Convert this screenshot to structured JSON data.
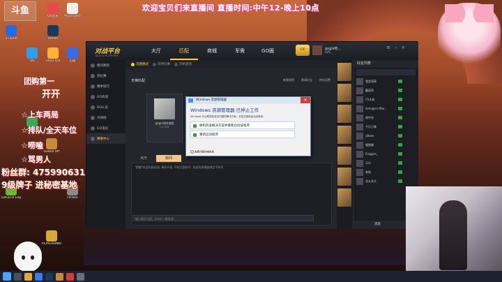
{
  "banner": {
    "text": "欢迎宝贝们来直播间   直播时间:中午12-晚上10点"
  },
  "logo_text": "斗鱼",
  "overlay": {
    "line1": "团购第一",
    "line2": "开开",
    "line3": "☆上车两局",
    "line4": "☆排队/全天车位",
    "line5": "☆唠嗑",
    "line6": "☆骂男人",
    "line7": "粉丝群: 475990631",
    "line8": "9级牌子 进秘密基地"
  },
  "desktop_icons": [
    {
      "label": "373200"
    },
    {
      "label": "QQ音乐"
    },
    {
      "label": "My project"
    },
    {
      "label": "Steam"
    },
    {
      "label": "QQ"
    },
    {
      "label": "2022 QQ"
    },
    {
      "label": "迅雷"
    },
    {
      "label": "360安全"
    },
    {
      "label": "Global Off"
    },
    {
      "label": "GeForce Experience"
    },
    {
      "label": "PLAYERUNKNOWN BATTLEGROUNDS"
    },
    {
      "label": "FitTake"
    }
  ],
  "app": {
    "logo": "对战平台",
    "logo_sub": "BATTLE PLATFORM",
    "nav": [
      "大厅",
      "匹配",
      "商城",
      "军需",
      "GO圈"
    ],
    "nav_active": 1,
    "vip_label": "VIP",
    "user_name": "gogis吧...",
    "level": "LV5",
    "sidebar": [
      "模块教程",
      "排位赛",
      "赛季排行",
      "GO商城",
      "ROLL房",
      "天梯榜",
      "GO电竞",
      "赛事中心"
    ],
    "sidebar_active": 7,
    "subnav": [
      "选图模式",
      "等待比赛",
      "开始游戏"
    ],
    "match_title": "天梯匹配",
    "match_tools": [
      "查看规则",
      "邀请好友",
      "房间设置"
    ],
    "room_name": "gogis吧的地图",
    "room_ip": "ELO988",
    "chat_tabs": [
      "大厅",
      "房间"
    ],
    "chat_line": "\"提醒\"欢迎光临对战, 请勿开挂, 开挂立即封号, 发送消息需要绑定手机号",
    "chat_input_placeholder": "输入聊天内容，Enter一键发送...",
    "friends_title": "好友列表",
    "friends": [
      {
        "name": "我是萌萌"
      },
      {
        "name": "蘑菇哥"
      },
      {
        "name": "CS大叔"
      },
      {
        "name": "Avengers-Mar..."
      },
      {
        "name": "周中杰"
      },
      {
        "name": "千乐万难"
      },
      {
        "name": "yBoke"
      },
      {
        "name": "猫猫猫"
      },
      {
        "name": "Froggen_"
      },
      {
        "name": "123"
      },
      {
        "name": "老狗"
      },
      {
        "name": "北从北大"
      }
    ],
    "friends_footer": "消息"
  },
  "dialog": {
    "title": "Windows 资源管理器",
    "heading": "Windows 资源管理器 已停止工作",
    "desc": "Windows 可以联机检查该问题的解决方案，并尝试重新启动该程序。",
    "option1": "联机检查解决方案并重新启动该程序",
    "option2": "重新启动程序",
    "details": "查看问题详细信息"
  }
}
